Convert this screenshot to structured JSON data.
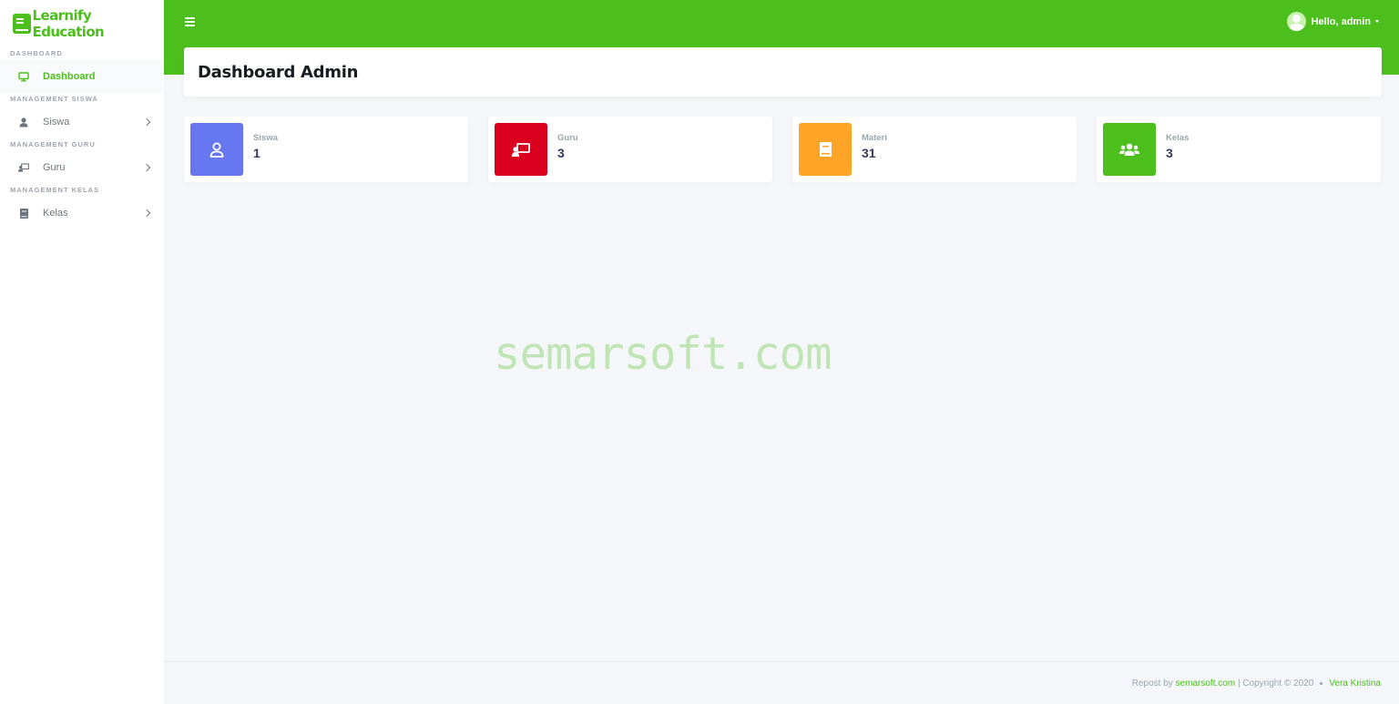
{
  "brand": {
    "name": "Learnify Education",
    "icon": "book-icon",
    "color": "#4cbf1d"
  },
  "sidebar": {
    "sections": [
      {
        "header": "DASHBOARD",
        "item": {
          "label": "Dashboard",
          "icon": "desktop-icon",
          "active": true,
          "has_submenu": false
        }
      },
      {
        "header": "MANAGEMENT SISWA",
        "item": {
          "label": "Siswa",
          "icon": "user-icon",
          "active": false,
          "has_submenu": true
        }
      },
      {
        "header": "MANAGEMENT GURU",
        "item": {
          "label": "Guru",
          "icon": "chalkboard-teacher-icon",
          "active": false,
          "has_submenu": true
        }
      },
      {
        "header": "MANAGEMENT KELAS",
        "item": {
          "label": "Kelas",
          "icon": "book-icon",
          "active": false,
          "has_submenu": true
        }
      }
    ]
  },
  "topbar": {
    "menu_icon": "hamburger-icon",
    "greeting": "Hello, admin",
    "avatar_icon": "avatar-icon"
  },
  "page": {
    "title": "Dashboard Admin"
  },
  "stats": [
    {
      "label": "Siswa",
      "value": "1",
      "icon": "user-outline-icon",
      "color": "#6777ef"
    },
    {
      "label": "Guru",
      "value": "3",
      "icon": "chalkboard-teacher-icon",
      "color": "#d9001f"
    },
    {
      "label": "Materi",
      "value": "31",
      "icon": "book-icon",
      "color": "#ffa426"
    },
    {
      "label": "Kelas",
      "value": "3",
      "icon": "users-icon",
      "color": "#4cbf1d"
    }
  ],
  "watermark": "semarsoft.com",
  "footer": {
    "repost_text": "Repost by",
    "repost_link": "semarsoft.com",
    "copyright": "| Copyright © 2020",
    "author": "Vera Kristina"
  }
}
